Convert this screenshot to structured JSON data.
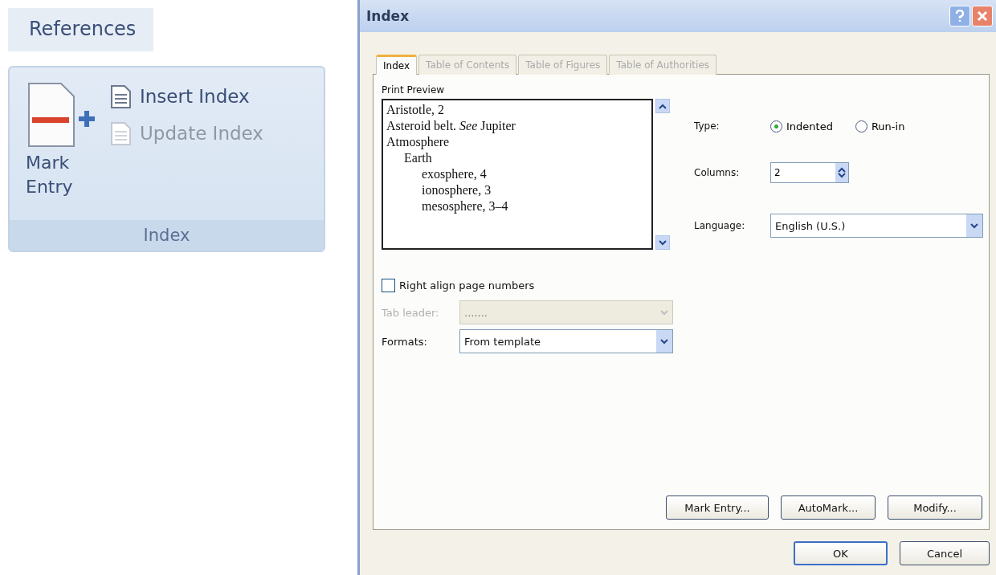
{
  "ribbon": {
    "tab": "References",
    "group": {
      "label": "Index",
      "large_button": {
        "label_lines": [
          "Mark",
          "Entry"
        ]
      },
      "small_buttons": [
        {
          "label": "Insert Index",
          "disabled": false
        },
        {
          "label": "Update Index",
          "disabled": true
        }
      ]
    }
  },
  "dialog": {
    "title": "Index",
    "tabs": [
      {
        "label": "Index",
        "selected": true
      },
      {
        "label": "Table of Contents",
        "selected": false
      },
      {
        "label": "Table of Figures",
        "selected": false
      },
      {
        "label": "Table of Authorities",
        "selected": false
      }
    ],
    "print_preview": {
      "label": "Print Preview",
      "entries": [
        {
          "text": "Aristotle, 2"
        },
        {
          "text": "Asteroid belt. *See* Jupiter"
        },
        {
          "text": "Atmosphere",
          "children": [
            {
              "text": "Earth",
              "children": [
                {
                  "text": "exosphere, 4"
                },
                {
                  "text": "ionosphere, 3"
                },
                {
                  "text": "mesosphere, 3–4"
                }
              ]
            }
          ]
        }
      ]
    },
    "type": {
      "label": "Type:",
      "options": [
        {
          "label": "Indented",
          "selected": true
        },
        {
          "label": "Run-in",
          "selected": false
        }
      ]
    },
    "columns": {
      "label": "Columns:",
      "value": "2"
    },
    "language": {
      "label": "Language:",
      "value": "English (U.S.)"
    },
    "right_align": {
      "label": "Right align page numbers",
      "checked": false
    },
    "tab_leader": {
      "label": "Tab leader:",
      "value": ".......",
      "disabled": true
    },
    "formats": {
      "label": "Formats:",
      "value": "From template"
    },
    "panel_buttons": [
      "Mark Entry...",
      "AutoMark...",
      "Modify..."
    ],
    "buttons": [
      {
        "label": "OK",
        "default": true
      },
      {
        "label": "Cancel",
        "default": false
      }
    ]
  }
}
